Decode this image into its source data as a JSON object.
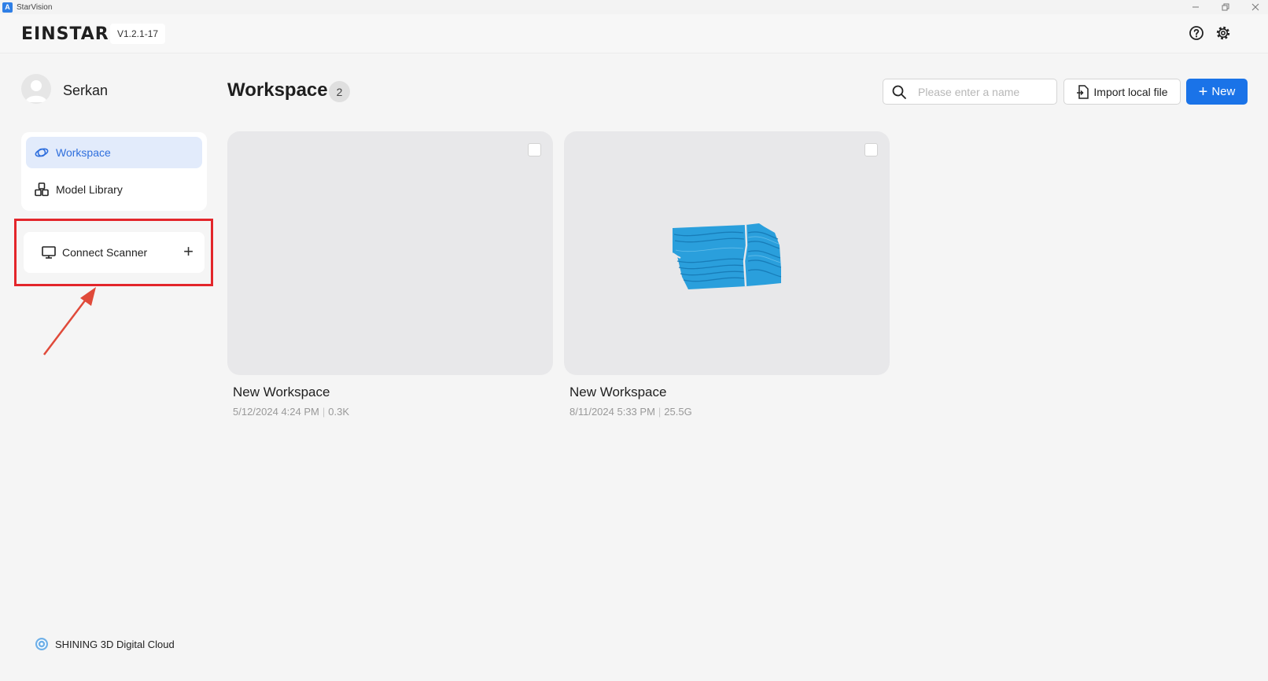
{
  "window": {
    "title": "StarVision",
    "app_icon_letter": "A"
  },
  "header": {
    "brand": "EINSTAR",
    "version": "V1.2.1-17"
  },
  "user": {
    "name": "Serkan"
  },
  "sidebar": {
    "items": [
      {
        "label": "Workspace",
        "icon": "workspace-icon",
        "active": true
      },
      {
        "label": "Model Library",
        "icon": "model-library-icon",
        "active": false
      }
    ],
    "scanner": {
      "label": "Connect Scanner",
      "action": "+"
    },
    "cloud": {
      "label": "SHINING 3D Digital Cloud"
    }
  },
  "main": {
    "title": "Workspace",
    "count": "2",
    "search": {
      "placeholder": "Please enter a name",
      "value": ""
    },
    "import_label": "Import local file",
    "new_label": "New",
    "new_icon": "+",
    "cards": [
      {
        "title": "New Workspace",
        "date": "5/12/2024 4:24 PM",
        "size": "0.3K",
        "has_preview": false
      },
      {
        "title": "New Workspace",
        "date": "8/11/2024 5:33 PM",
        "size": "25.5G",
        "has_preview": true
      }
    ]
  },
  "colors": {
    "accent": "#1a73e8",
    "highlight": "#e3262b",
    "active_bg": "#e2ebfb",
    "scan_model": "#2a9fdc"
  }
}
